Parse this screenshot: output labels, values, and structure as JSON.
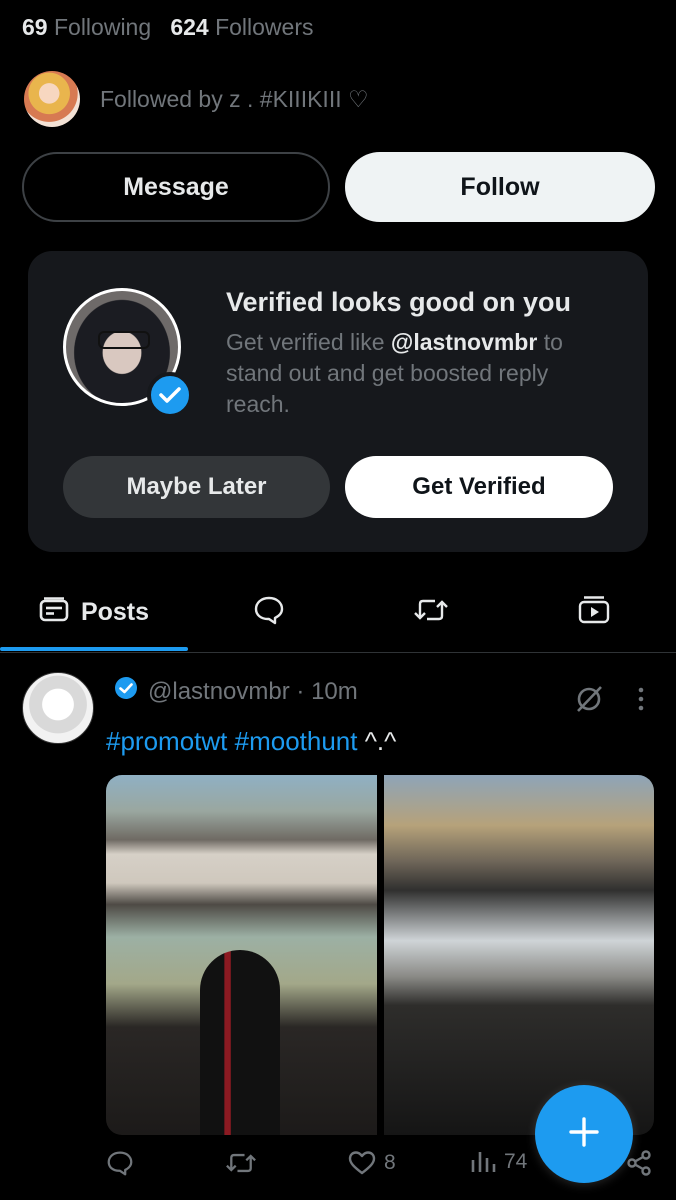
{
  "profile": {
    "following_count": "69",
    "following_label": "Following",
    "followers_count": "624",
    "followers_label": "Followers",
    "followed_by": "Followed by z . #KIIIKIII ♡"
  },
  "actions": {
    "message_label": "Message",
    "follow_label": "Follow"
  },
  "verified_card": {
    "title": "Verified looks good on you",
    "desc_prefix": "Get verified like ",
    "desc_handle": "@lastnovmbr",
    "desc_suffix": " to stand out and get boosted reply reach.",
    "maybe_later_label": "Maybe Later",
    "get_verified_label": "Get Verified"
  },
  "tabs": [
    {
      "label": "Posts",
      "icon": "posts-icon",
      "active": true
    },
    {
      "label": "",
      "icon": "replies-icon"
    },
    {
      "label": "",
      "icon": "reposts-icon"
    },
    {
      "label": "",
      "icon": "media-icon"
    }
  ],
  "post": {
    "handle": "@lastnovmbr",
    "time": "· 10m",
    "hashtag1": "#promotwt",
    "hashtag2": "#moothunt",
    "text_tail": " ^.^",
    "likes": "8",
    "views": "74"
  },
  "colors": {
    "accent": "#1d9bf0",
    "background": "#000000",
    "card": "#16181c",
    "muted": "#71767b"
  }
}
